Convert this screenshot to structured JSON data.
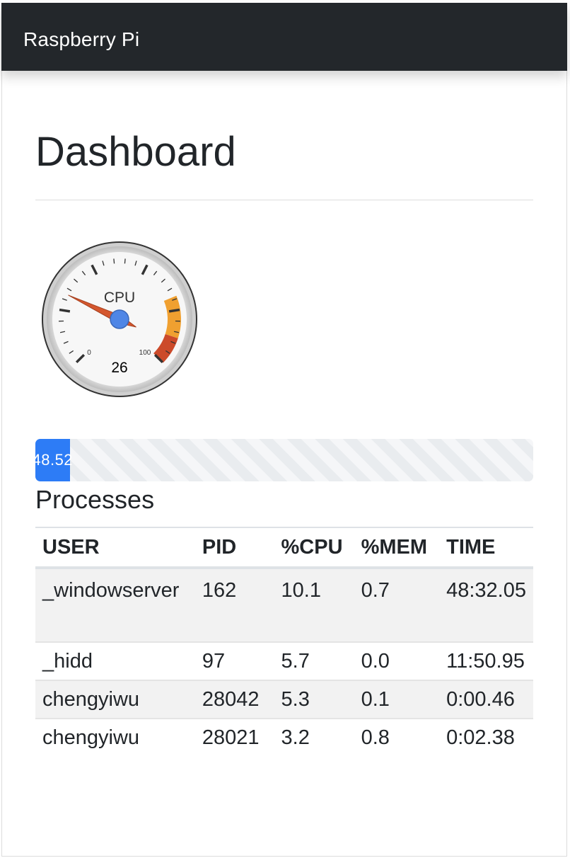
{
  "navbar": {
    "brand": "Raspberry Pi"
  },
  "page": {
    "title": "Dashboard"
  },
  "gauge": {
    "label": "CPU",
    "value": 26,
    "min": 0,
    "max": 100,
    "min_label": "0",
    "max_label": "100"
  },
  "progress": {
    "value": 48.52,
    "label": "48.52",
    "max": 704
  },
  "processes": {
    "title": "Processes",
    "columns": [
      "USER",
      "PID",
      "%CPU",
      "%MEM",
      "TIME"
    ],
    "rows": [
      {
        "user": "_windowserver",
        "pid": "162",
        "cpu": "10.1",
        "mem": "0.7",
        "time": "48:32.05"
      },
      {
        "user": "_hidd",
        "pid": "97",
        "cpu": "5.7",
        "mem": "0.0",
        "time": "11:50.95"
      },
      {
        "user": "chengyiwu",
        "pid": "28042",
        "cpu": "5.3",
        "mem": "0.1",
        "time": "0:00.46"
      },
      {
        "user": "chengyiwu",
        "pid": "28021",
        "cpu": "3.2",
        "mem": "0.8",
        "time": "0:02.38"
      }
    ]
  },
  "colors": {
    "navbar": "#23272b",
    "progress": "#2d7cf6",
    "gauge_yellow": "#f0a030",
    "gauge_red": "#cc4a2a",
    "needle": "#d4572e",
    "hub": "#4f86e6"
  }
}
